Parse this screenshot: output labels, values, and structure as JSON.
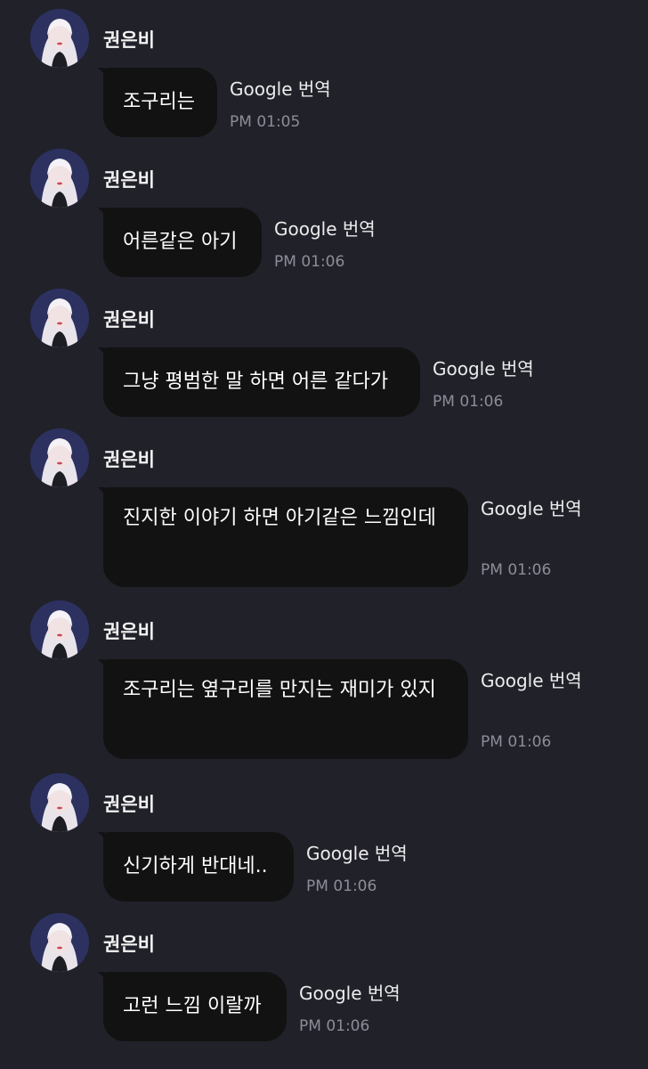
{
  "messages": [
    {
      "sender": "권은비",
      "text": "조구리는",
      "translate": "Google 번역",
      "time": "PM 01:05"
    },
    {
      "sender": "권은비",
      "text": "어른같은 아기",
      "translate": "Google 번역",
      "time": "PM 01:06"
    },
    {
      "sender": "권은비",
      "text": "그냥 평범한 말 하면 어른 같다가",
      "translate": "Google 번역",
      "time": "PM 01:06"
    },
    {
      "sender": "권은비",
      "text": "진지한 이야기 하면 아기같은 느낌인데",
      "translate": "Google 번역",
      "time": "PM 01:06"
    },
    {
      "sender": "권은비",
      "text": "조구리는 옆구리를 만지는 재미가 있지",
      "translate": "Google 번역",
      "time": "PM 01:06"
    },
    {
      "sender": "권은비",
      "text": "신기하게 반대네..",
      "translate": "Google 번역",
      "time": "PM 01:06"
    },
    {
      "sender": "권은비",
      "text": "고런 느낌 이랄까",
      "translate": "Google 번역",
      "time": "PM 01:06"
    }
  ]
}
